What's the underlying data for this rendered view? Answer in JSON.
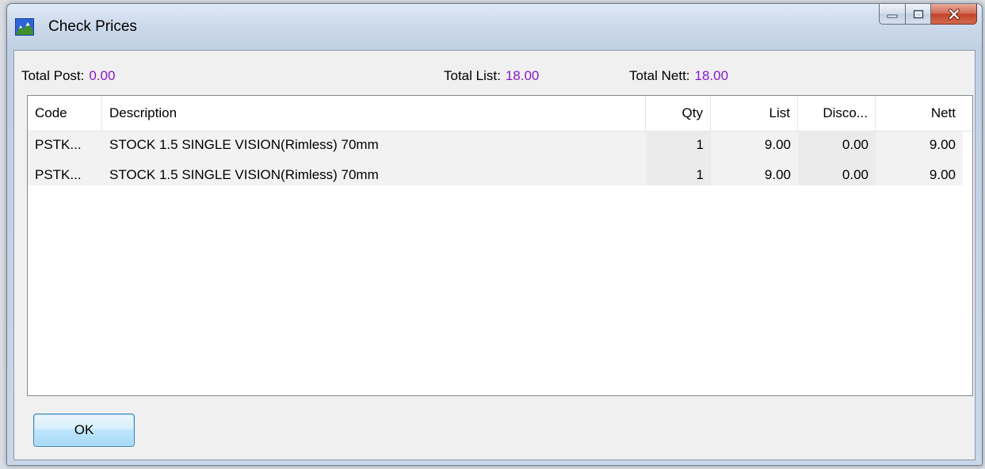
{
  "window": {
    "title": "Check Prices",
    "icon": "mountain-app-icon",
    "controls": {
      "minimize": "minimize-icon",
      "maximize": "maximize-icon",
      "close": "close-icon"
    }
  },
  "totals": {
    "post_label": "Total Post:",
    "post_value": "0.00",
    "list_label": "Total List:",
    "list_value": "18.00",
    "nett_label": "Total Nett:",
    "nett_value": "18.00",
    "value_color": "#8a18c9"
  },
  "grid": {
    "headers": {
      "code": "Code",
      "description": "Description",
      "qty": "Qty",
      "list": "List",
      "discount": "Disco...",
      "nett": "Nett"
    },
    "rows": [
      {
        "code": "PSTK...",
        "description": "STOCK 1.5 SINGLE VISION(Rimless) 70mm",
        "qty": "1",
        "list": "9.00",
        "discount": "0.00",
        "nett": "9.00"
      },
      {
        "code": "PSTK...",
        "description": "STOCK 1.5 SINGLE VISION(Rimless) 70mm",
        "qty": "1",
        "list": "9.00",
        "discount": "0.00",
        "nett": "9.00"
      }
    ]
  },
  "buttons": {
    "ok_label": "OK"
  }
}
